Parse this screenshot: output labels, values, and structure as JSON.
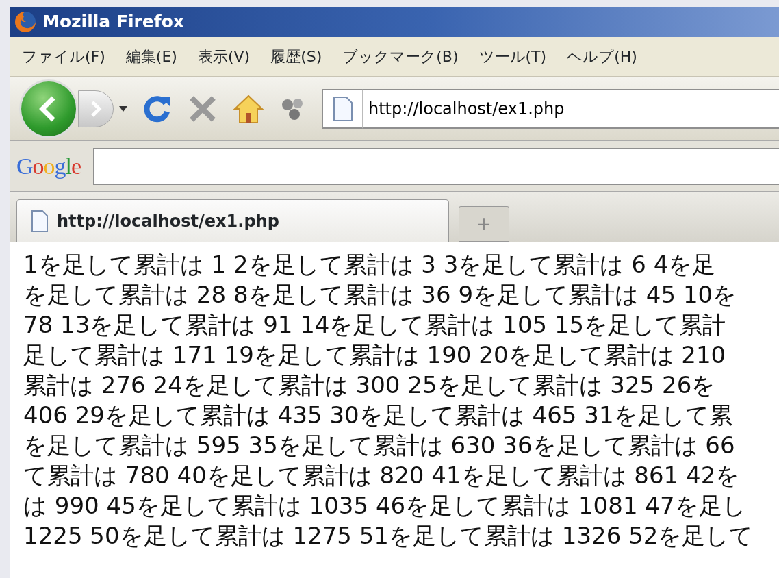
{
  "window": {
    "title": "Mozilla Firefox"
  },
  "menu": [
    "ファイル(F)",
    "編集(E)",
    "表示(V)",
    "履歴(S)",
    "ブックマーク(B)",
    "ツール(T)",
    "ヘルプ(H)"
  ],
  "address_bar": {
    "value": "http://localhost/ex1.php"
  },
  "search_bar": {
    "logo": "Google"
  },
  "tabs": [
    {
      "label": "http://localhost/ex1.php",
      "selected": true
    }
  ],
  "new_tab": "+",
  "content": {
    "lines": [
      "1を足して累計は 1 2を足して累計は 3 3を足して累計は 6 4を足",
      "を足して累計は 28 8を足して累計は 36 9を足して累計は 45 10を",
      "78 13を足して累計は 91 14を足して累計は 105 15を足して累計",
      "足して累計は 171 19を足して累計は 190 20を足して累計は 210",
      "累計は 276 24を足して累計は 300 25を足して累計は 325 26を",
      "406 29を足して累計は 435 30を足して累計は 465 31を足して累",
      "を足して累計は 595 35を足して累計は 630 36を足して累計は 66",
      "て累計は 780 40を足して累計は 820 41を足して累計は 861 42を",
      "は 990 45を足して累計は 1035 46を足して累計は 1081 47を足し",
      "1225 50を足して累計は 1275 51を足して累計は 1326 52を足して"
    ]
  }
}
